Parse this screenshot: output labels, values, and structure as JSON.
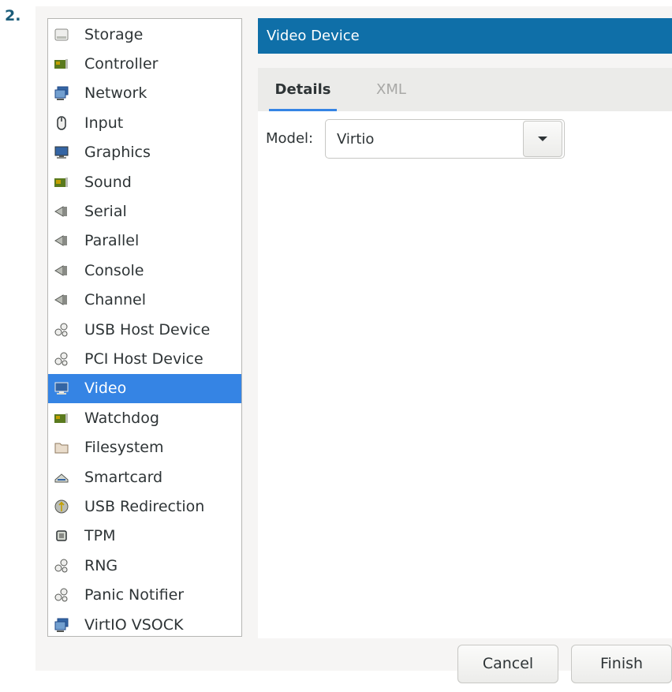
{
  "step_label": "2.",
  "sidebar": {
    "items": [
      {
        "label": "Storage",
        "icon": "storage-icon"
      },
      {
        "label": "Controller",
        "icon": "controller-icon"
      },
      {
        "label": "Network",
        "icon": "network-icon"
      },
      {
        "label": "Input",
        "icon": "mouse-icon"
      },
      {
        "label": "Graphics",
        "icon": "monitor-icon"
      },
      {
        "label": "Sound",
        "icon": "sound-card-icon"
      },
      {
        "label": "Serial",
        "icon": "serial-port-icon"
      },
      {
        "label": "Parallel",
        "icon": "parallel-port-icon"
      },
      {
        "label": "Console",
        "icon": "console-icon"
      },
      {
        "label": "Channel",
        "icon": "channel-icon"
      },
      {
        "label": "USB Host Device",
        "icon": "usb-host-icon"
      },
      {
        "label": "PCI Host Device",
        "icon": "pci-host-icon"
      },
      {
        "label": "Video",
        "icon": "video-icon",
        "selected": true
      },
      {
        "label": "Watchdog",
        "icon": "watchdog-icon"
      },
      {
        "label": "Filesystem",
        "icon": "folder-icon"
      },
      {
        "label": "Smartcard",
        "icon": "smartcard-icon"
      },
      {
        "label": "USB Redirection",
        "icon": "usb-redirection-icon"
      },
      {
        "label": "TPM",
        "icon": "chip-icon"
      },
      {
        "label": "RNG",
        "icon": "rng-icon"
      },
      {
        "label": "Panic Notifier",
        "icon": "panic-notifier-icon"
      },
      {
        "label": "VirtIO VSOCK",
        "icon": "vsock-icon"
      }
    ]
  },
  "header": {
    "title": "Video Device"
  },
  "tabs": [
    {
      "label": "Details",
      "active": true
    },
    {
      "label": "XML",
      "active": false
    }
  ],
  "details": {
    "model_label": "Model:",
    "model_value": "Virtio"
  },
  "buttons": {
    "cancel": "Cancel",
    "finish": "Finish"
  },
  "colors": {
    "selection": "#3584e4",
    "header": "#0f6fa8"
  }
}
